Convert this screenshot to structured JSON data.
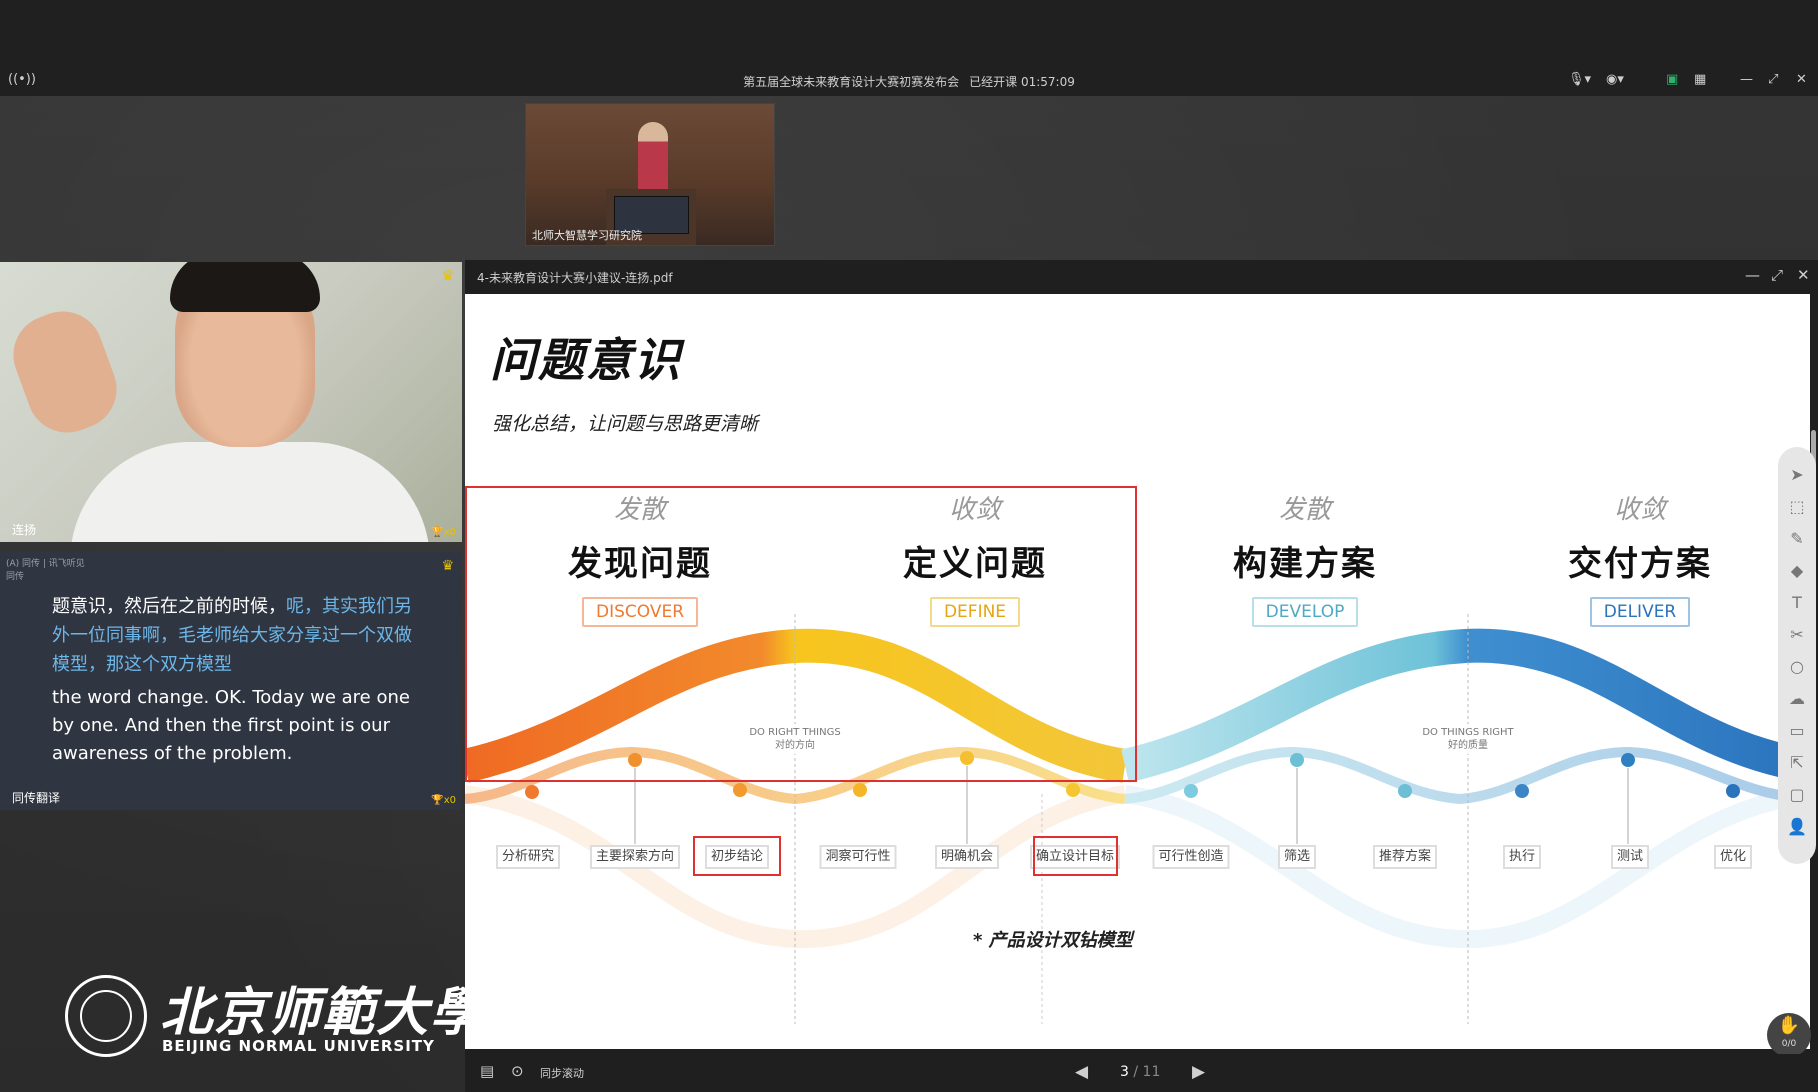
{
  "window": {
    "title": "第五届全球未来教育设计大赛初赛发布会",
    "elapsed_label": "已经开课 01:57:09",
    "live_icon": "broadcast-icon",
    "right_icons": [
      "mic-icon",
      "camera-icon",
      "screen-share-icon",
      "layout-icon",
      "minimize-icon",
      "restore-icon",
      "close-icon"
    ]
  },
  "lecturer": {
    "caption": "北师大智慧学习研究院"
  },
  "speaker": {
    "name": "连扬",
    "gift_count": "x0"
  },
  "translation": {
    "header": "(A) 同传 | 讯飞听见",
    "header_sub": "同传",
    "zh_prefix": "题意识，然后在之前的时候，",
    "zh_highlight": "呢，其实我们另外一位同事啊，毛老师给大家分享过一个双做模型，那这个双方模型",
    "en": "the word change. OK. Today we are one by one. And then the first point is our awareness of the problem.",
    "name": "同传翻译",
    "gift_count": "x0"
  },
  "logo": {
    "cn": "北京师範大學",
    "en": "BEIJING NORMAL UNIVERSITY"
  },
  "pdf": {
    "filename": "4-未来教育设计大赛小建议-连扬.pdf",
    "slide": {
      "title": "问题意识",
      "subtitle": "强化总结，让问题与思路更清晰",
      "caption": "* 产品设计双钻模型",
      "phases": [
        {
          "kind": "发散",
          "cn": "发现问题",
          "en": "DISCOVER",
          "color": "#ef7a2f"
        },
        {
          "kind": "收敛",
          "cn": "定义问题",
          "en": "DEFINE",
          "color": "#f2b01c"
        },
        {
          "kind": "发散",
          "cn": "构建方案",
          "en": "DEVELOP",
          "color": "#6cbfd4"
        },
        {
          "kind": "收敛",
          "cn": "交付方案",
          "en": "DELIVER",
          "color": "#2f7fc3"
        }
      ],
      "mid_labels": [
        {
          "en": "DO RIGHT THINGS",
          "cn": "对的方向"
        },
        {
          "en": "DO THINGS RIGHT",
          "cn": "好的质量"
        }
      ],
      "steps": [
        "分析研究",
        "主要探索方向",
        "初步结论",
        "洞察可行性",
        "明确机会",
        "确立设计目标",
        "可行性创造",
        "筛选",
        "推荐方案",
        "执行",
        "测试",
        "优化"
      ]
    },
    "bottom": {
      "sync_label": "同步滚动",
      "page_current": "3",
      "page_total": " / 11"
    },
    "fab_label": "0/0"
  }
}
